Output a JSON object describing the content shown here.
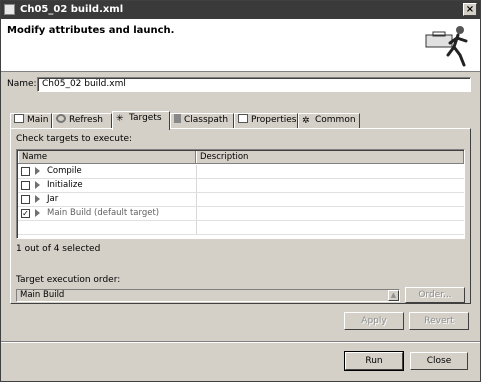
{
  "window": {
    "title": "Ch05_02 build.xml"
  },
  "header": {
    "message": "Modify attributes and launch."
  },
  "name_field": {
    "label": "Name:",
    "value": "Ch05_02 build.xml"
  },
  "tabs": [
    {
      "label": "Main",
      "icon": "main-tab-icon"
    },
    {
      "label": "Refresh",
      "icon": "refresh-icon"
    },
    {
      "label": "Targets",
      "icon": "targets-icon"
    },
    {
      "label": "Classpath",
      "icon": "classpath-icon"
    },
    {
      "label": "Properties",
      "icon": "properties-icon"
    },
    {
      "label": "Common",
      "icon": "common-icon"
    }
  ],
  "active_tab": "Targets",
  "targets": {
    "check_label": "Check targets to execute:",
    "columns": [
      "Name",
      "Description"
    ],
    "rows": [
      {
        "name": "Compile",
        "checked": false
      },
      {
        "name": "Initialize",
        "checked": false
      },
      {
        "name": "Jar",
        "checked": false
      },
      {
        "name": "Main Build (default target)",
        "checked": true
      }
    ],
    "selected_count": "1 out of 4 selected",
    "order_label": "Target execution order:",
    "order_value": "Main Build",
    "order_button": "Order..."
  },
  "buttons": {
    "apply": "Apply",
    "revert": "Revert",
    "run": "Run",
    "close": "Close"
  },
  "colors": {
    "titlebar": "#3a3a3a",
    "face": "#d4d0c8"
  }
}
